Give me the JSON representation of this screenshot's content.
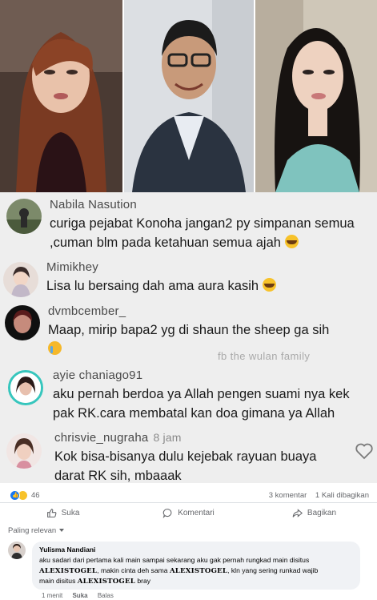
{
  "comments": [
    {
      "name": "Nabila Nasution",
      "time": "",
      "text": "curiga pejabat Konoha jangan2 py simpanan semua ,cuman blm pada ketahuan semua ajah",
      "emoji": "grinning-sweat-emoji"
    },
    {
      "name": "Mimikhey",
      "time": "",
      "text": "Lisa lu bersaing dah ama aura kasih",
      "emoji": "tears-of-joy-emoji"
    },
    {
      "name": "dvmbcember_",
      "time": "",
      "text": "Maap, mirip bapa2 yg di shaun the sheep ga sih",
      "emoji": "crying-emoji"
    },
    {
      "name": "ayie chaniago91",
      "time": "",
      "text": "aku pernah berdoa ya Allah pengen suami nya kek pak RK.cara membatal kan doa gimana ya Allah",
      "emoji": ""
    },
    {
      "name": "chrisvie_nugraha",
      "time": "8 jam",
      "text": "Kok bisa-bisanya dulu kejebak rayuan buaya darat RK sih, mbaaak",
      "emoji": ""
    }
  ],
  "watermark": "fb the wulan family",
  "post": {
    "reaction_count": "46",
    "comment_count": "3 komentar",
    "share_count": "1 Kali dibagikan",
    "like_label": "Suka",
    "comment_label": "Komentari",
    "share_label": "Bagikan",
    "sort_label": "Paling relevan"
  },
  "reply": {
    "name": "Yulisma Nandiani",
    "text_1": "aku sadari dari pertama kali main sampai sekarang aku gak pernah rungkad main disitus",
    "brand": "ALEXISTOGEL",
    "text_2": ", makin cinta deh sama",
    "text_3": ", kln yang sering runkad wajib",
    "text_4": "main disitus",
    "text_5": "bray",
    "time": "1 menit",
    "like": "Suka",
    "reply": "Balas"
  },
  "colors": {
    "fb_blue": "#1877f2",
    "comment_bg": "#eeeeee",
    "bubble_bg": "#f0f2f5"
  }
}
